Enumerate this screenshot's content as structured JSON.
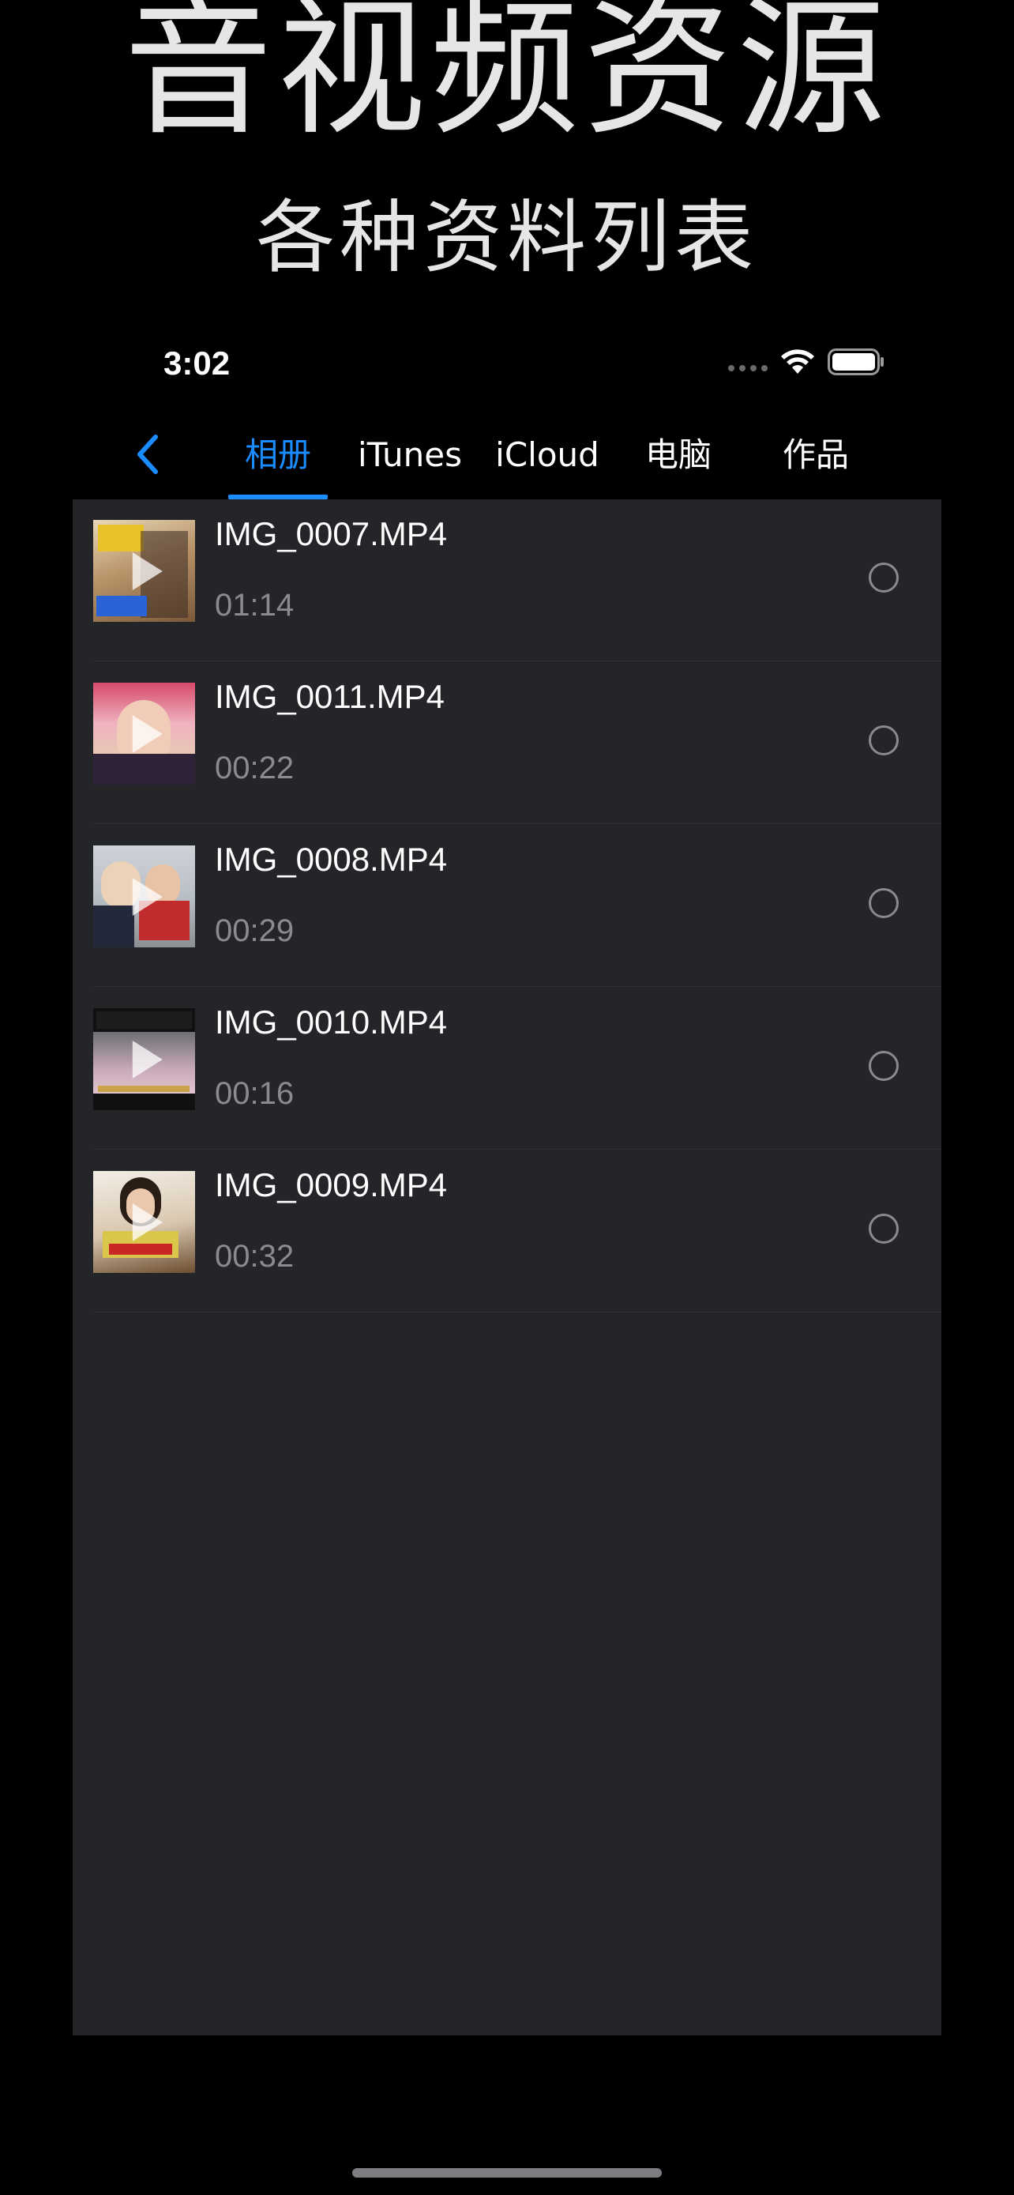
{
  "promo": {
    "title": "音视频资源",
    "subtitle": "各种资料列表"
  },
  "status_bar": {
    "time": "3:02",
    "wifi_icon": "wifi-icon",
    "battery_icon": "battery-icon"
  },
  "nav": {
    "back_icon": "chevron-left-icon",
    "tabs": [
      {
        "label": "相册",
        "active": true
      },
      {
        "label": "iTunes",
        "active": false
      },
      {
        "label": "iCloud",
        "active": false
      },
      {
        "label": "电脑",
        "active": false
      },
      {
        "label": "作品",
        "active": false
      }
    ]
  },
  "files": [
    {
      "name": "IMG_0007.MP4",
      "duration": "01:14",
      "selected": false
    },
    {
      "name": "IMG_0011.MP4",
      "duration": "00:22",
      "selected": false
    },
    {
      "name": "IMG_0008.MP4",
      "duration": "00:29",
      "selected": false
    },
    {
      "name": "IMG_0010.MP4",
      "duration": "00:16",
      "selected": false
    },
    {
      "name": "IMG_0009.MP4",
      "duration": "00:32",
      "selected": false
    }
  ],
  "colors": {
    "accent": "#1a8cff",
    "background": "#000000",
    "panel": "#242529",
    "secondary_text": "#8a8b90"
  }
}
